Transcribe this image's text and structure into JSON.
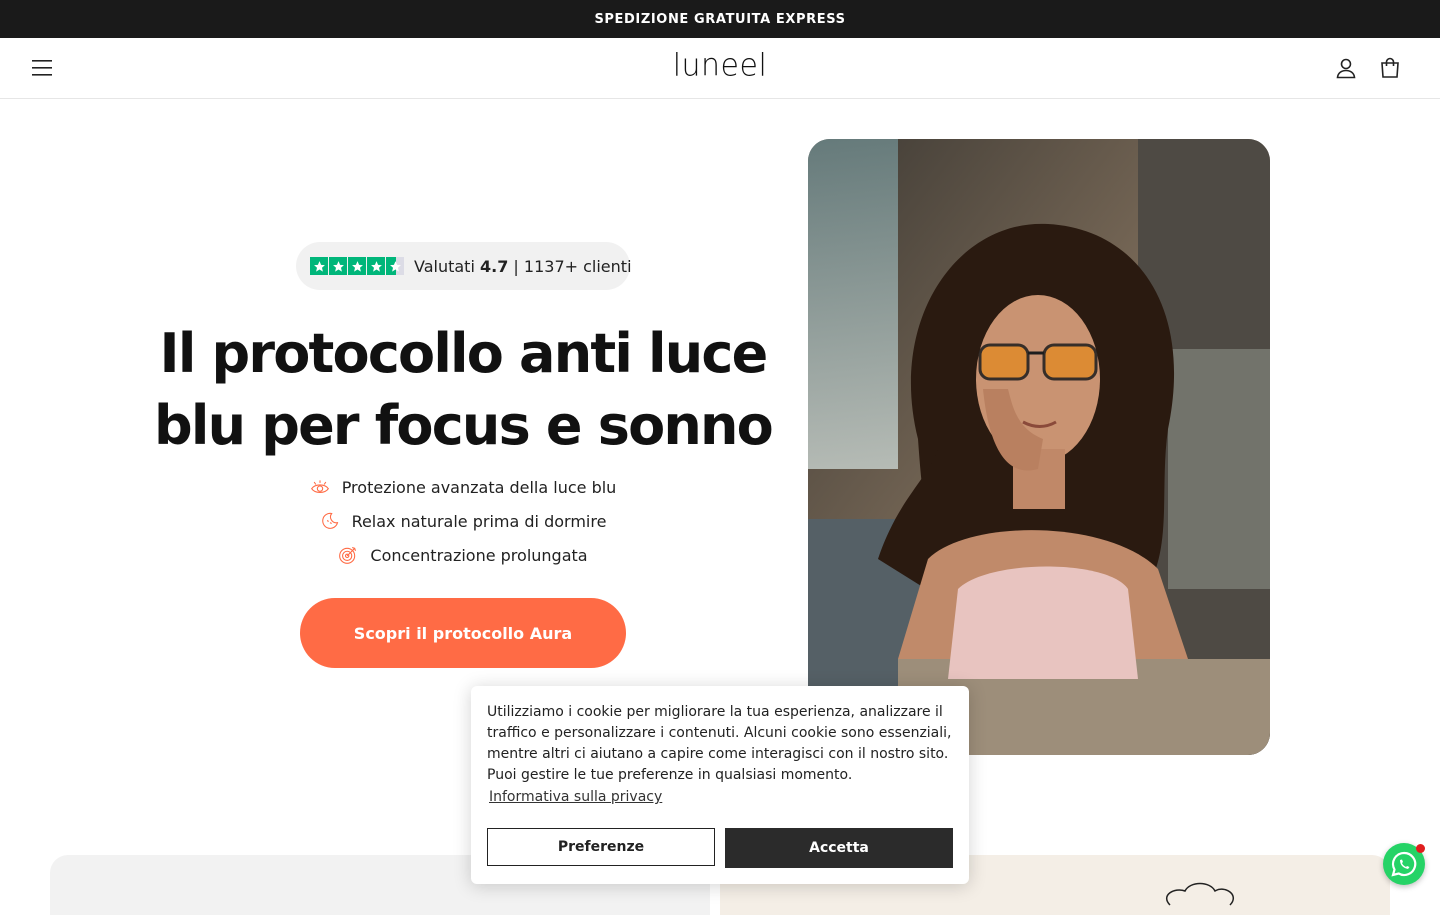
{
  "announcement": {
    "text": "SPEDIZIONE GRATUITA EXPRESS"
  },
  "header": {
    "brand": "luneel"
  },
  "hero": {
    "rating": {
      "prefix": "Valutati",
      "score": "4.7",
      "separator": "|",
      "count_text": "1137+ clienti"
    },
    "title": "Il protocollo anti luce blu per focus e sonno",
    "features": [
      {
        "icon": "eye-icon",
        "label": "Protezione avanzata della luce blu"
      },
      {
        "icon": "moon-stars-icon",
        "label": "Relax naturale prima di dormire"
      },
      {
        "icon": "target-icon",
        "label": "Concentrazione prolungata"
      }
    ],
    "cta": "Scopri il protocollo Aura",
    "accent_color": "#ff6b45"
  },
  "cookie_banner": {
    "text": "Utilizziamo i cookie per migliorare la tua esperienza, analizzare il traffico e personalizzare i contenuti. Alcuni cookie sono essenziali, mentre altri ci aiutano a capire come interagisci con il nostro sito. Puoi gestire le tue preferenze in qualsiasi momento.",
    "privacy_link": "Informativa sulla privacy",
    "preferences_button": "Preferenze",
    "accept_button": "Accetta"
  },
  "colors": {
    "trustpilot_green": "#00b67a",
    "whatsapp_green": "#25d366",
    "announcement_bg": "#1a1a1a"
  }
}
